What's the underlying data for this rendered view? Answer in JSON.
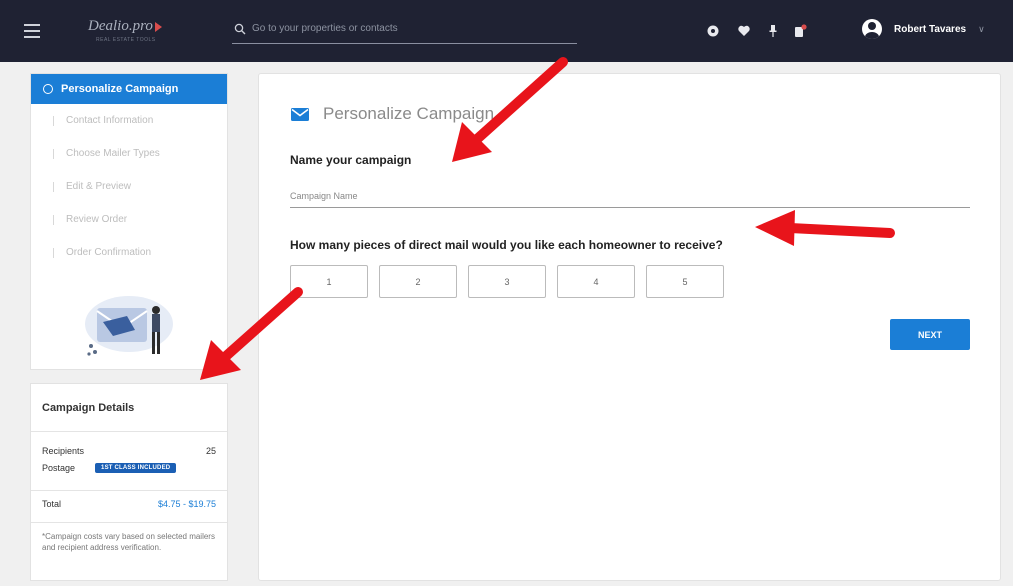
{
  "topbar": {
    "logo_text": "Dealio.pro",
    "logo_sub": "REAL ESTATE TOOLS",
    "search_placeholder": "Go to your properties or contacts",
    "icons": [
      "gear-icon",
      "heart-icon",
      "pin-icon",
      "notification-icon"
    ],
    "user_name": "Robert Tavares",
    "user_chevron": "∨"
  },
  "steps": {
    "active": "Personalize Campaign",
    "items": [
      "Contact Information",
      "Choose Mailer Types",
      "Edit & Preview",
      "Review Order",
      "Order Confirmation"
    ]
  },
  "details": {
    "title": "Campaign Details",
    "recipients_label": "Recipients",
    "recipients_value": "25",
    "postage_label": "Postage",
    "postage_badge": "1ST CLASS INCLUDED",
    "total_label": "Total",
    "total_value": "$4.75 - $19.75",
    "note": "*Campaign costs vary based on selected mailers and recipient address verification."
  },
  "main": {
    "title": "Personalize Campaign",
    "name_question": "Name your campaign",
    "name_placeholder": "Campaign Name",
    "pieces_question": "How many pieces of direct mail would you like each homeowner to receive?",
    "options": [
      "1",
      "2",
      "3",
      "4",
      "5"
    ],
    "next_label": "NEXT"
  },
  "colors": {
    "topbar_bg": "#1f2233",
    "accent": "#1b7ed6",
    "annotation_arrow": "#e8141b"
  }
}
